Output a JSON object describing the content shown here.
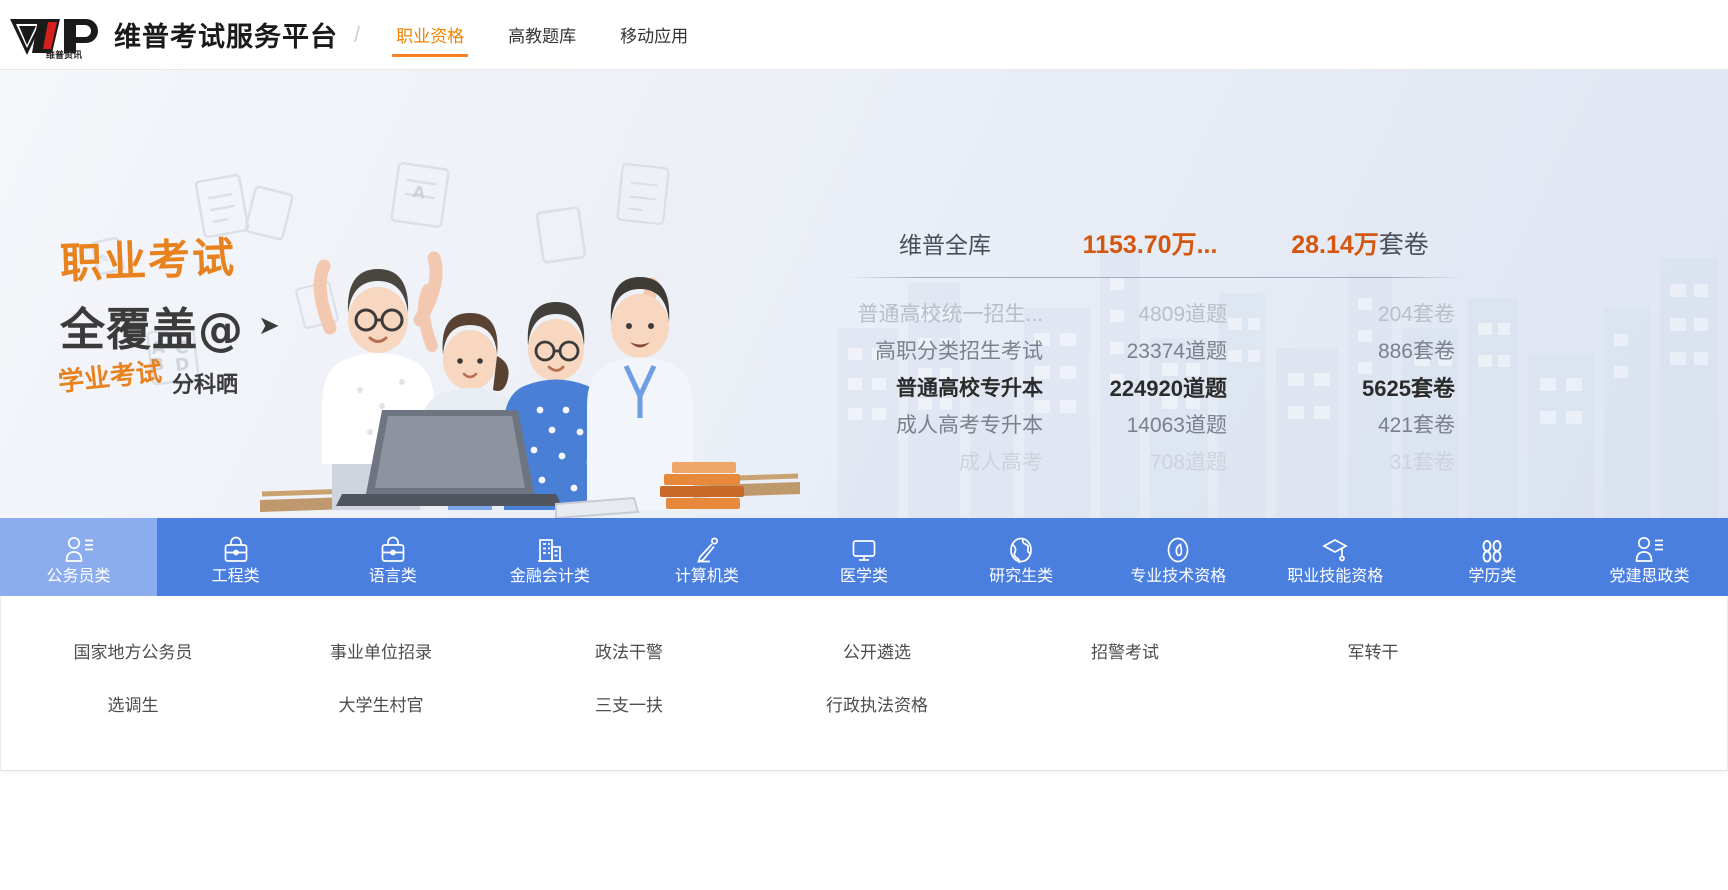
{
  "header": {
    "logo_alt": "维普资讯",
    "logo_sub": "维普资讯",
    "brand": "维普考试服务平台",
    "separator": "/",
    "tabs": [
      {
        "label": "职业资格",
        "active": true
      },
      {
        "label": "高教题库",
        "active": false
      },
      {
        "label": "移动应用",
        "active": false
      }
    ]
  },
  "banner": {
    "slogan_line1": "职业考试",
    "slogan_line2": "全覆盖@",
    "slogan_arrow": "➤",
    "slogan_line3_a": "学业考试",
    "slogan_line3_b": "分科晒"
  },
  "stats": {
    "header": {
      "name": "维普全库",
      "questions": "1153.70万...",
      "papers_value": "28.14万",
      "papers_unit": "套卷"
    },
    "rows": [
      {
        "name": "普通高校统一招生...",
        "questions": "4809道题",
        "papers": "204套卷",
        "style": "dim"
      },
      {
        "name": "高职分类招生考试",
        "questions": "23374道题",
        "papers": "886套卷",
        "style": "mid"
      },
      {
        "name": "普通高校专升本",
        "questions": "224920道题",
        "papers": "5625套卷",
        "style": "bold"
      },
      {
        "name": "成人高考专升本",
        "questions": "14063道题",
        "papers": "421套卷",
        "style": "mid"
      },
      {
        "name": "成人高考",
        "questions": "708道题",
        "papers": "31套卷",
        "style": "faint"
      }
    ]
  },
  "categories": [
    {
      "label": "公务员类",
      "icon": "user-list-icon",
      "active": true
    },
    {
      "label": "工程类",
      "icon": "briefcase-icon",
      "active": false
    },
    {
      "label": "语言类",
      "icon": "briefcase-icon",
      "active": false
    },
    {
      "label": "金融会计类",
      "icon": "building-icon",
      "active": false
    },
    {
      "label": "计算机类",
      "icon": "pencil-icon",
      "active": false
    },
    {
      "label": "医学类",
      "icon": "monitor-icon",
      "active": false
    },
    {
      "label": "研究生类",
      "icon": "globe-icon",
      "active": false
    },
    {
      "label": "专业技术资格",
      "icon": "compass-icon",
      "active": false
    },
    {
      "label": "职业技能资格",
      "icon": "graduation-icon",
      "active": false
    },
    {
      "label": "学历类",
      "icon": "grid-icon",
      "active": false
    },
    {
      "label": "党建思政类",
      "icon": "user-list-icon",
      "active": false
    }
  ],
  "sublinks": {
    "row1": [
      "国家地方公务员",
      "事业单位招录",
      "政法干警",
      "公开遴选",
      "招警考试",
      "军转干"
    ],
    "row2": [
      "选调生",
      "大学生村官",
      "三支一扶",
      "行政执法资格",
      "",
      ""
    ]
  },
  "colors": {
    "accent_orange": "#f5811f",
    "stat_orange": "#d4570f",
    "nav_blue": "#4a7fe0",
    "nav_blue_active": "#8badee"
  }
}
